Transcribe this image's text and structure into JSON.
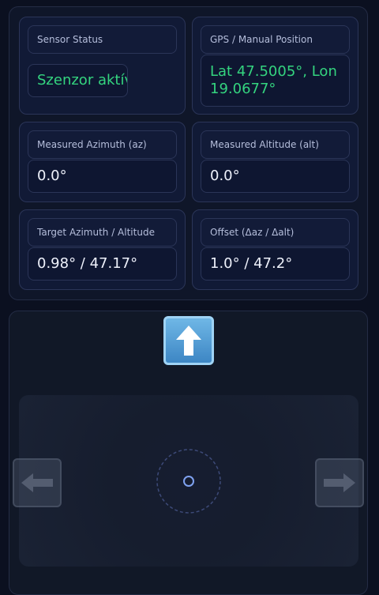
{
  "sensor_status": {
    "label": "Sensor Status",
    "value": "Szenzor aktív"
  },
  "gps": {
    "label": "GPS / Manual Position",
    "value": "Lat 47.5005°, Lon 19.0677°"
  },
  "measured_azimuth": {
    "label": "Measured Azimuth (az)",
    "value": "0.0°"
  },
  "measured_altitude": {
    "label": "Measured Altitude (alt)",
    "value": "0.0°"
  },
  "target": {
    "label": "Target Azimuth / Altitude",
    "value": "0.98° / 47.17°"
  },
  "offset": {
    "label": "Offset (Δaz / Δalt)",
    "value": "1.0° / 47.2°"
  },
  "controls": {
    "up_icon": "arrow-up-icon",
    "left_icon": "arrow-left-icon",
    "right_icon": "arrow-right-icon",
    "target_marker_icon": "target-ring-icon"
  },
  "colors": {
    "status_green": "#34d47f",
    "marker_blue": "#7fa2f0",
    "up_button_blue": "#4a90d0"
  }
}
